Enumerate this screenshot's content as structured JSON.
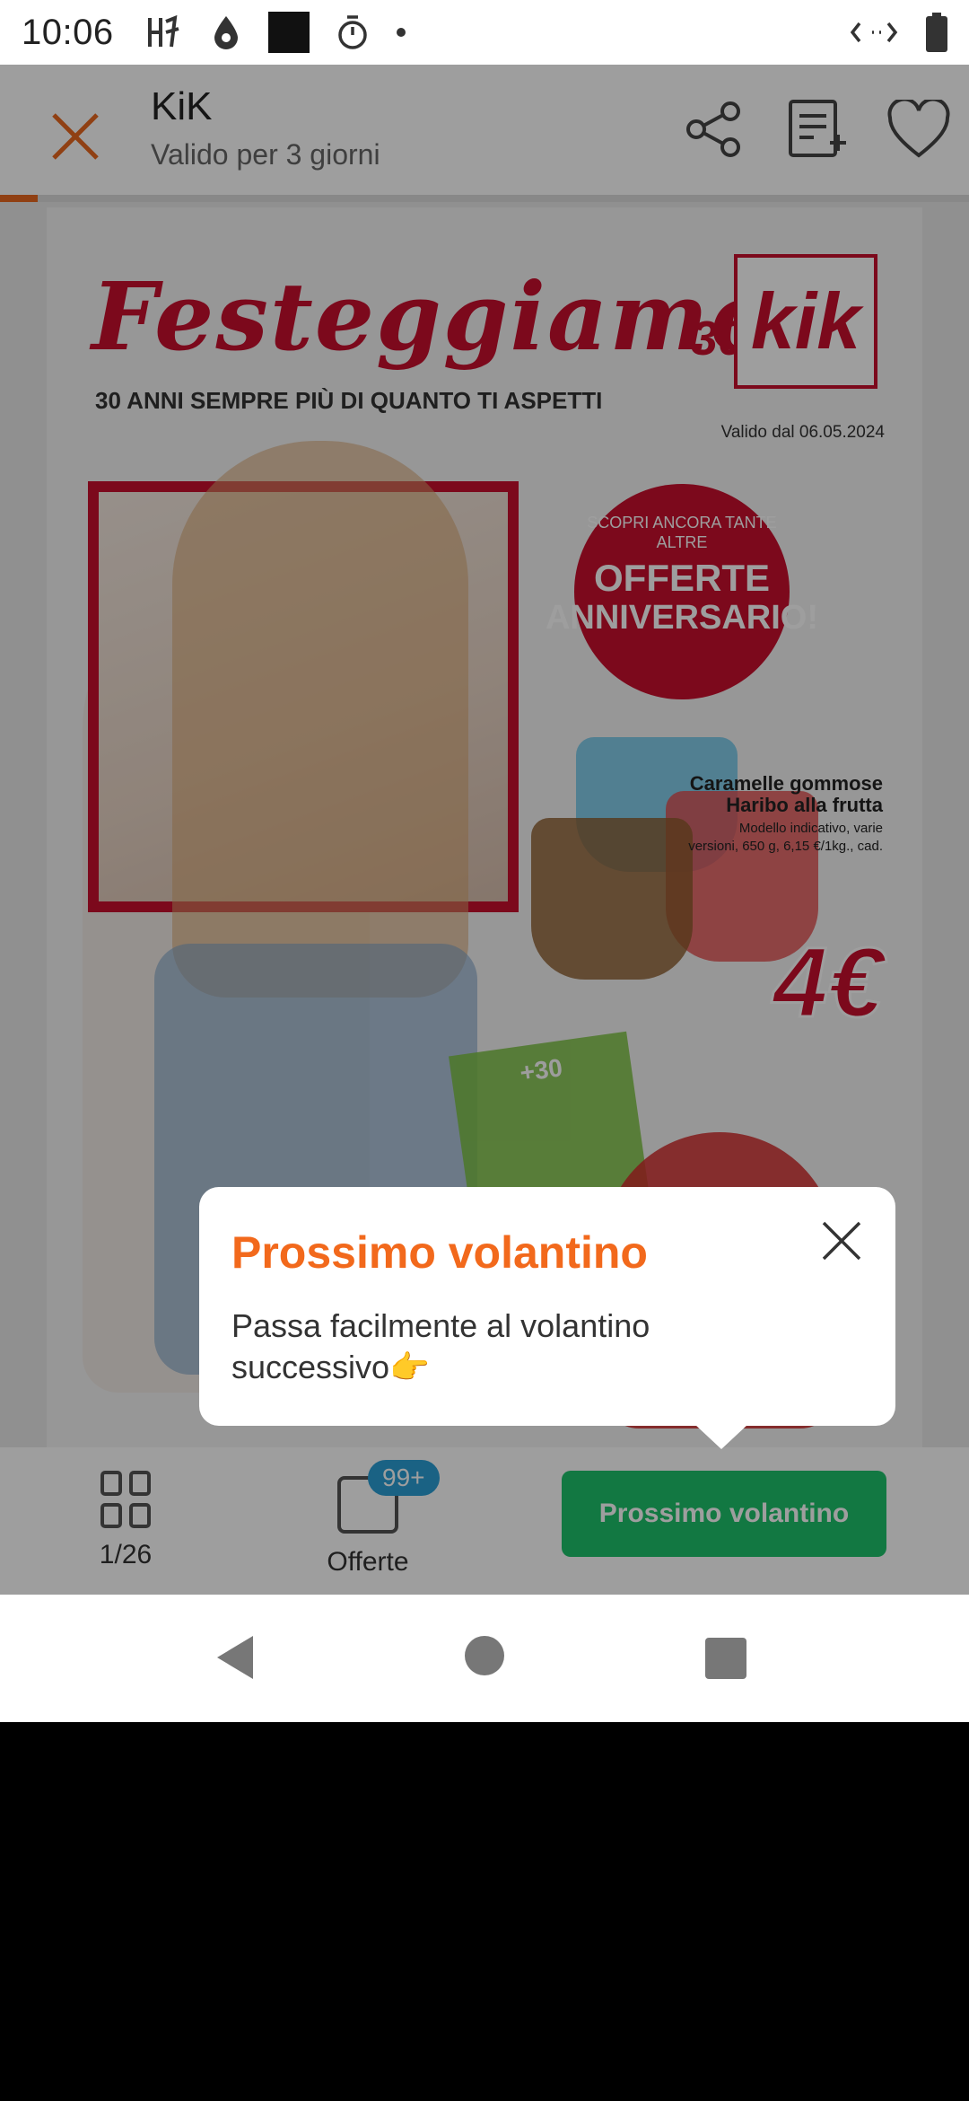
{
  "status_bar": {
    "time": "10:06",
    "icons": [
      "harry-potter-icon",
      "water-drop-icon",
      "square-icon",
      "timer-icon",
      "dot-icon"
    ],
    "right_icons": [
      "data-saver-icon",
      "battery-icon"
    ]
  },
  "header": {
    "title": "KiK",
    "subtitle": "Valido per 3 giorni",
    "actions": [
      "share-icon",
      "shopping-list-icon",
      "heart-icon"
    ]
  },
  "progress": {
    "fraction": 0.0385
  },
  "flyer": {
    "headline": "Festeggiamo",
    "tagline": "30 ANNI SEMPRE PIÙ DI QUANTO TI ASPETTI",
    "logo_text": "kik",
    "logo_30": "30",
    "valid_from": "Valido dal 06.05.2024",
    "badge_small": "SCOPRI ANCORA TANTE ALTRE",
    "badge_line1": "OFFERTE",
    "badge_line2": "ANNIVERSARIO!",
    "product_title": "Caramelle gommose Haribo alla frutta",
    "product_sub": "Modello indicativo, varie versioni, 650 g, 6,15 €/1kg., cad.",
    "price": "4€",
    "balloon_label": "+30"
  },
  "bottom_bar": {
    "pages_label": "1/26",
    "offers_label": "Offerte",
    "offers_count": "99+",
    "next_button": "Prossimo volantino"
  },
  "tooltip": {
    "title": "Prossimo volantino",
    "body": "Passa facilmente al volantino successivo👉"
  },
  "colors": {
    "accent_orange": "#f2691c",
    "green_button": "#1ec26b",
    "kik_red": "#c8102e",
    "badge_blue": "#2a9fd6"
  }
}
